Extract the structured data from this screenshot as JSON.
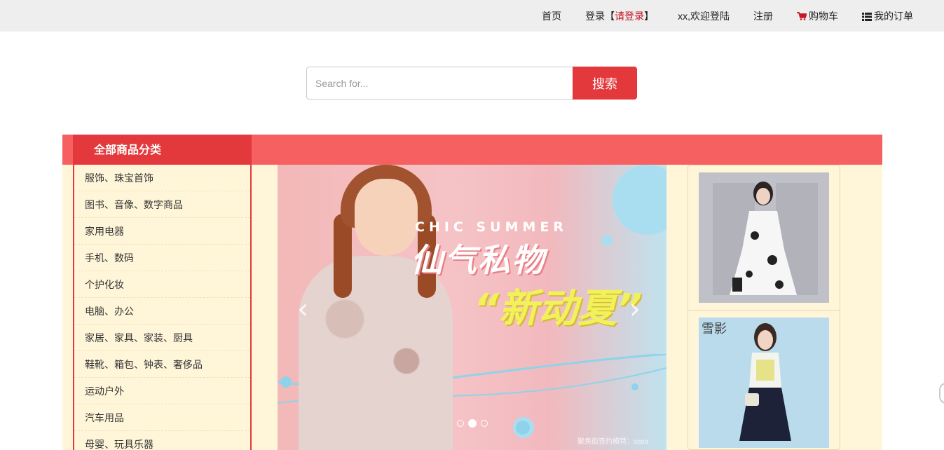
{
  "topnav": {
    "home": "首页",
    "login_prefix": "登录【",
    "login_link": "请登录",
    "login_suffix": "】",
    "welcome": "xx,欢迎登陆",
    "register": "注册",
    "cart": "购物车",
    "orders": "我的订单"
  },
  "search": {
    "placeholder": "Search for...",
    "button_label": "搜索"
  },
  "category": {
    "title": "全部商品分类",
    "items": [
      "服饰、珠宝首饰",
      "图书、音像、数字商品",
      "家用电器",
      "手机、数码",
      "个护化妆",
      "电脑、办公",
      "家居、家具、家装、厨具",
      "鞋靴、箱包、钟表、奢侈品",
      "运动户外",
      "汽车用品",
      "母婴、玩具乐器"
    ]
  },
  "banner": {
    "text_en": "CHIC SUMMER",
    "text_cn_1": "仙气私物",
    "text_cn_2": "“新动夏”",
    "caption": "聚焦街签约模特：sasa",
    "prev_label": "‹",
    "next_label": "›",
    "slide_count": 3,
    "active_slide": 2
  },
  "side_products": {
    "brand_text": "雪影"
  },
  "colors": {
    "accent_red": "#e4393c",
    "band_red": "#f76060",
    "panel_bg": "#fff6d9",
    "topbar_bg": "#eeeeee"
  },
  "icons": [
    "cart-icon",
    "list-icon",
    "chevron-left-icon",
    "chevron-right-icon"
  ]
}
